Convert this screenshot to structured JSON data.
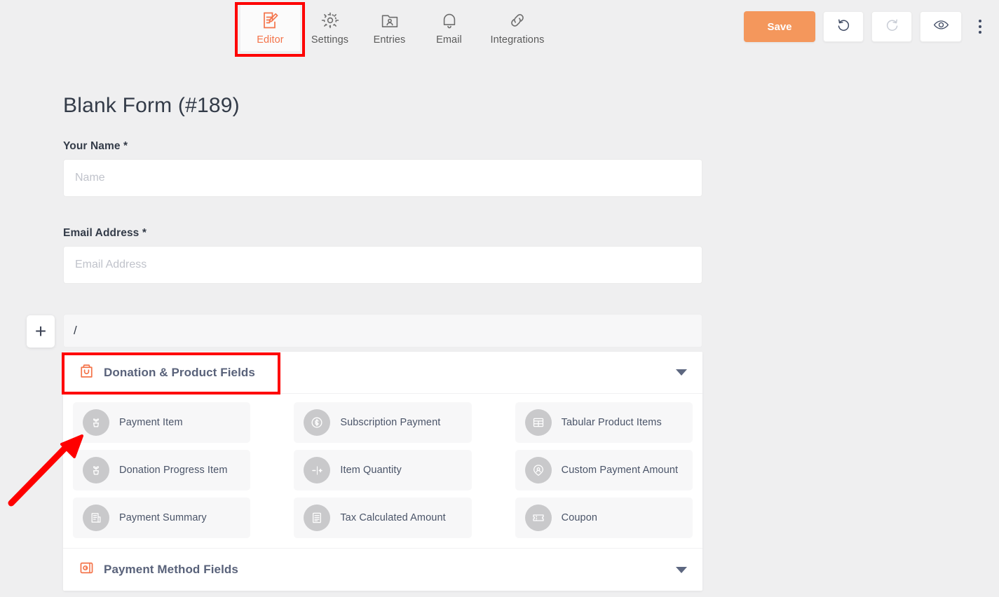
{
  "colors": {
    "accent_orange": "#f4744a",
    "save_button": "#f4975c",
    "annotation_red": "#fe0000",
    "page_background": "#efeff0",
    "icon_disc_gray": "#c9c9cb",
    "group_title": "#59627a"
  },
  "topbar": {
    "tabs": [
      {
        "label": "Editor",
        "icon": "editor-icon",
        "active": true
      },
      {
        "label": "Settings",
        "icon": "gear-icon",
        "active": false
      },
      {
        "label": "Entries",
        "icon": "entries-icon",
        "active": false
      },
      {
        "label": "Email",
        "icon": "bell-icon",
        "active": false
      },
      {
        "label": "Integrations",
        "icon": "link-icon",
        "active": false
      }
    ],
    "actions": {
      "save_label": "Save",
      "undo_icon": "undo-icon",
      "redo_icon": "redo-icon",
      "preview_icon": "eye-icon",
      "more_icon": "kebab-menu-icon"
    }
  },
  "form": {
    "title": "Blank Form (#189)",
    "fields": [
      {
        "label": "Your Name *",
        "placeholder": "Name",
        "value": ""
      },
      {
        "label": "Email Address *",
        "placeholder": "Email Address",
        "value": ""
      }
    ],
    "add_button_glyph": "+",
    "search": {
      "value": "/",
      "placeholder": ""
    }
  },
  "field_panel": {
    "groups": [
      {
        "title": "Donation & Product Fields",
        "icon": "donation-box-icon",
        "expanded": true,
        "caret": "chevron-down-icon",
        "items": [
          {
            "label": "Payment Item",
            "icon": "plant-pot-icon"
          },
          {
            "label": "Subscription Payment",
            "icon": "dollar-coin-icon"
          },
          {
            "label": "Tabular Product Items",
            "icon": "table-grid-icon"
          },
          {
            "label": "Donation Progress Item",
            "icon": "plant-pot-icon"
          },
          {
            "label": "Item Quantity",
            "icon": "minus-plus-icon"
          },
          {
            "label": "Custom Payment Amount",
            "icon": "person-pin-icon"
          },
          {
            "label": "Payment Summary",
            "icon": "receipt-icon"
          },
          {
            "label": "Tax Calculated Amount",
            "icon": "document-lines-icon"
          },
          {
            "label": "Coupon",
            "icon": "ticket-icon"
          }
        ]
      },
      {
        "title": "Payment Method Fields",
        "icon": "wallet-card-icon",
        "expanded": false,
        "caret": "chevron-down-icon",
        "items": []
      }
    ]
  },
  "annotations": {
    "editor_tab_box": "highlight-editor-tab",
    "donation_group_box": "highlight-donation-group-header",
    "payment_item_arrow": "arrow-pointing-to-payment-item"
  }
}
